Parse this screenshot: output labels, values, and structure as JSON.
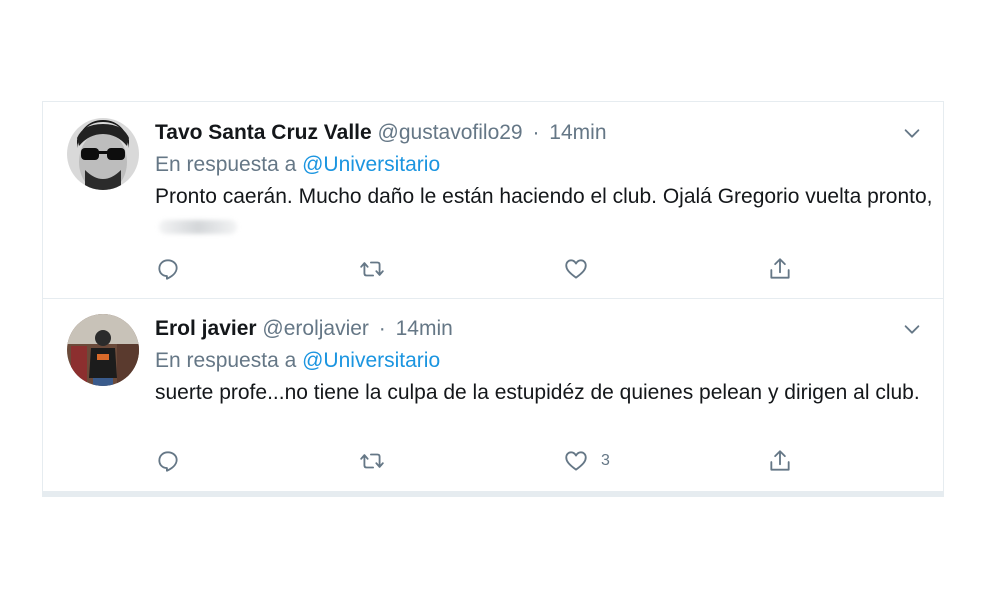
{
  "tweets": [
    {
      "name": "Tavo Santa Cruz Valle",
      "handle": "@gustavofilo29",
      "separator": "·",
      "time": "14min",
      "reply_prefix": "En respuesta a",
      "reply_to": "@Universitario",
      "text": "Pronto caerán. Mucho daño le están haciendo el club. Ojalá Gregorio vuelta pronto,",
      "like_count": ""
    },
    {
      "name": "Erol javier",
      "handle": "@eroljavier",
      "separator": "·",
      "time": "14min",
      "reply_prefix": "En respuesta a",
      "reply_to": "@Universitario",
      "text": "suerte profe...no tiene la culpa de la estupidéz de quienes  pelean y dirigen al club.",
      "like_count": "3"
    }
  ],
  "icons": {
    "reply": "reply-icon",
    "retweet": "retweet-icon",
    "like": "heart-icon",
    "share": "share-icon",
    "more": "chevron-down-icon"
  },
  "colors": {
    "text": "#14171a",
    "muted": "#657786",
    "link": "#1b95e0",
    "border": "#e6ecf0"
  }
}
